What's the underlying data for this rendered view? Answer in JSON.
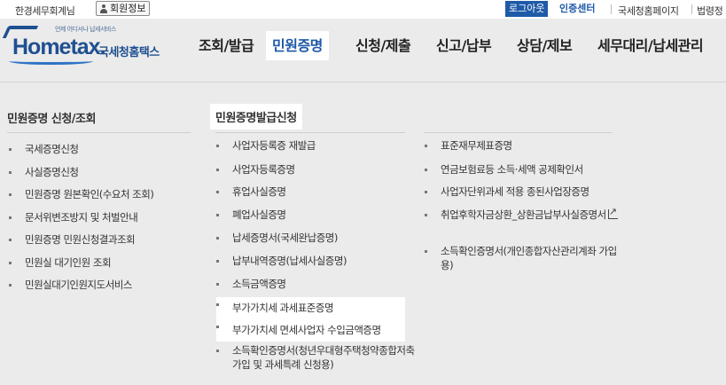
{
  "topbar": {
    "user_text": "한경세무회계님",
    "my_info": "회원정보",
    "logout": "로그아웃",
    "cert_center": "인증센터",
    "nts_page": "국세청홈페이지",
    "law": "법령정"
  },
  "logo": {
    "sub": "언제 어디서나 납세서비스",
    "main": "Hometax.",
    "kr": "국세청홈택스"
  },
  "gnb": [
    "조회/발급",
    "민원증명",
    "신청/제출",
    "신고/납부",
    "상담/제보",
    "세무대리/납세관리"
  ],
  "active_gnb": "민원증명",
  "columns": [
    {
      "title": "민원증명 신청/조회",
      "items": [
        "국세증명신청",
        "사실증명신청",
        "민원증명 원본확인(수요처 조회)",
        "문서위변조방지 및 처벌안내",
        "민원증명 민원신청결과조회",
        "민원실 대기인원 조회",
        "민원실대기인원지도서비스"
      ]
    },
    {
      "title": "민원증명발급신청",
      "items": [
        "사업자등록증 재발급",
        "사업자등록증명",
        "휴업사실증명",
        "폐업사실증명",
        "납세증명서(국세완납증명)",
        "납부내역증명(납세사실증명)",
        "소득금액증명",
        "부가가치세 과세표준증명",
        "부가가치세 면세사업자 수입금액증명",
        "소득확인증명서(청년우대형주택청약종합저축 가입 및 과세특례 신청용)"
      ]
    },
    {
      "title": "",
      "items": [
        "표준재무제표증명",
        "연금보험료등 소득·세액 공제확인서",
        "사업자단위과세 적용 종된사업장증명",
        "취업후학자금상환_상환금납부사실증명서",
        "소득확인증명서(개인종합자산관리계좌 가입용)"
      ]
    }
  ],
  "colors": {
    "accent": "#1e5aa8",
    "background": "#ebebeb",
    "highlight": "#ffffff"
  }
}
